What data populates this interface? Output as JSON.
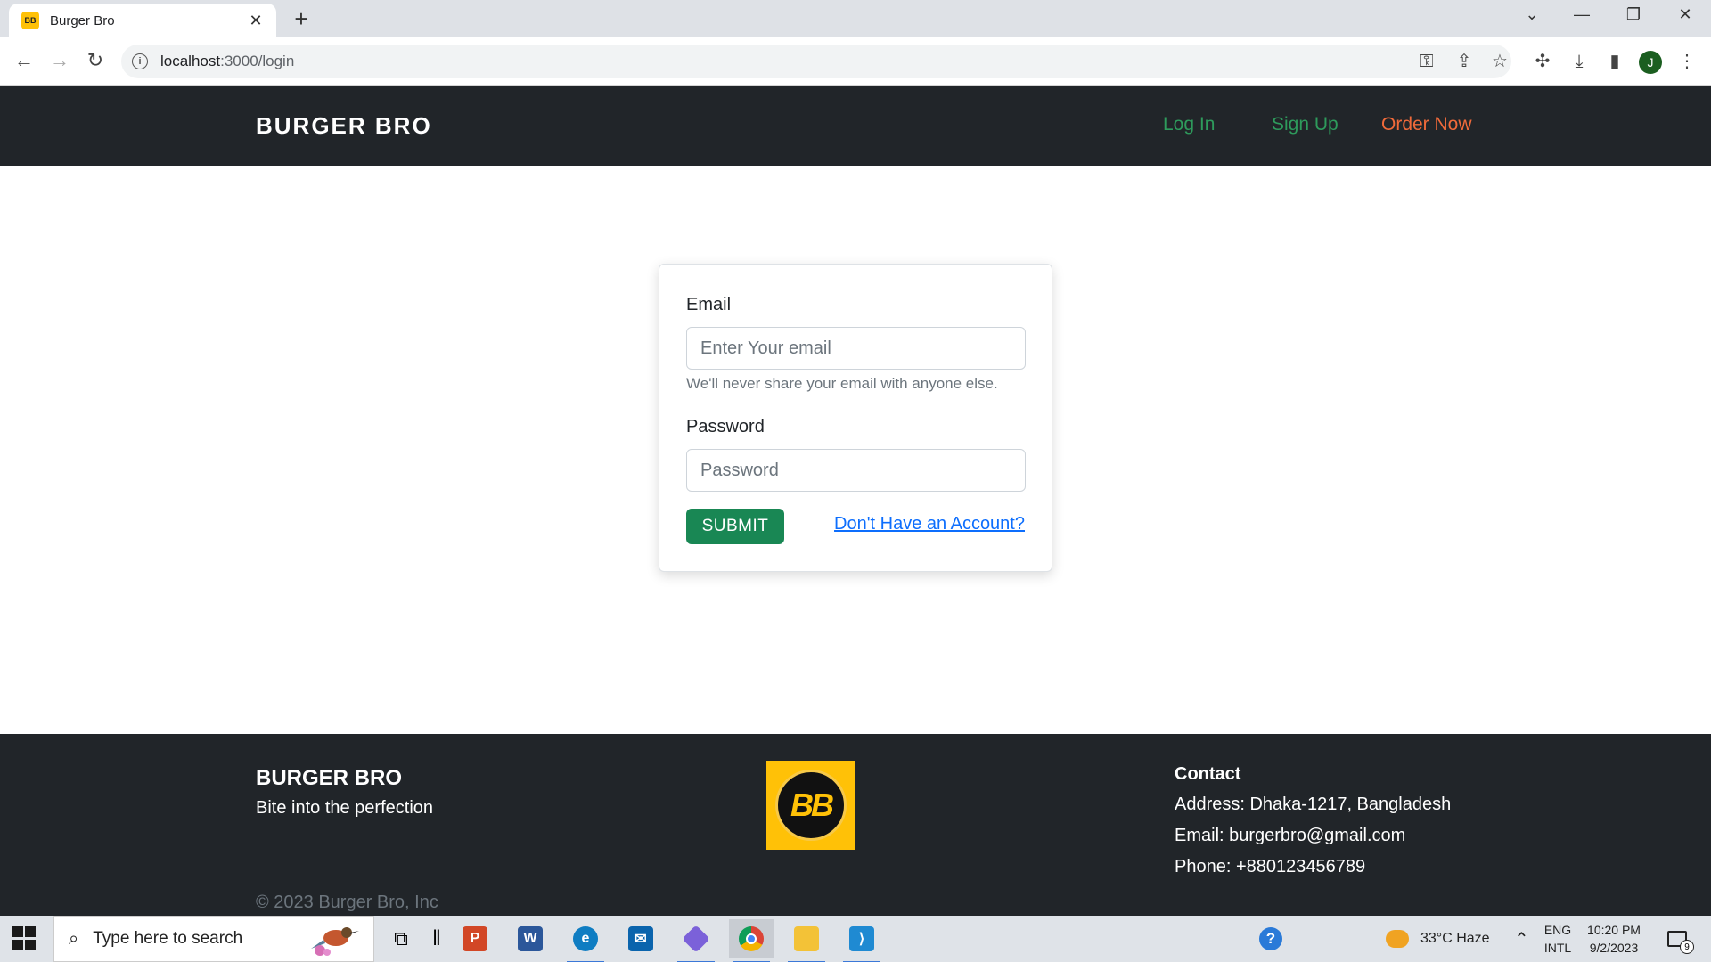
{
  "browser": {
    "tab_title": "Burger Bro",
    "tab_favicon_text": "BB",
    "url_host": "localhost",
    "url_path": ":3000/login",
    "profile_initial": "J"
  },
  "navbar": {
    "brand": "BURGER BRO",
    "links": {
      "login": "Log In",
      "signup": "Sign Up",
      "order": "Order Now"
    },
    "colors": {
      "login": "#2e9b5c",
      "signup": "#2e9b5c",
      "order": "#f06a3a",
      "background": "#212529"
    }
  },
  "login_form": {
    "email_label": "Email",
    "email_placeholder": "Enter Your email",
    "email_help": "We'll never share your email with anyone else.",
    "password_label": "Password",
    "password_placeholder": "Password",
    "submit_label": "SUBMIT",
    "signup_link": "Don't Have an Account?"
  },
  "footer": {
    "brand": "BURGER BRO",
    "tagline": "Bite into the perfection",
    "logo_text": "BB",
    "contact_heading": "Contact",
    "address": "Address: Dhaka-1217, Bangladesh",
    "email": "Email: burgerbro@gmail.com",
    "phone": "Phone: +880123456789",
    "copyright": "© 2023 Burger Bro, Inc"
  },
  "taskbar": {
    "search_placeholder": "Type here to search",
    "weather": "33°C  Haze",
    "language_top": "ENG",
    "language_bottom": "INTL",
    "time": "10:20 PM",
    "date": "9/2/2023",
    "notification_count": "9",
    "pinned_apps": [
      "task-view",
      "powerpoint",
      "word",
      "edge",
      "mail",
      "copilot",
      "chrome",
      "file-explorer",
      "vscode"
    ]
  }
}
